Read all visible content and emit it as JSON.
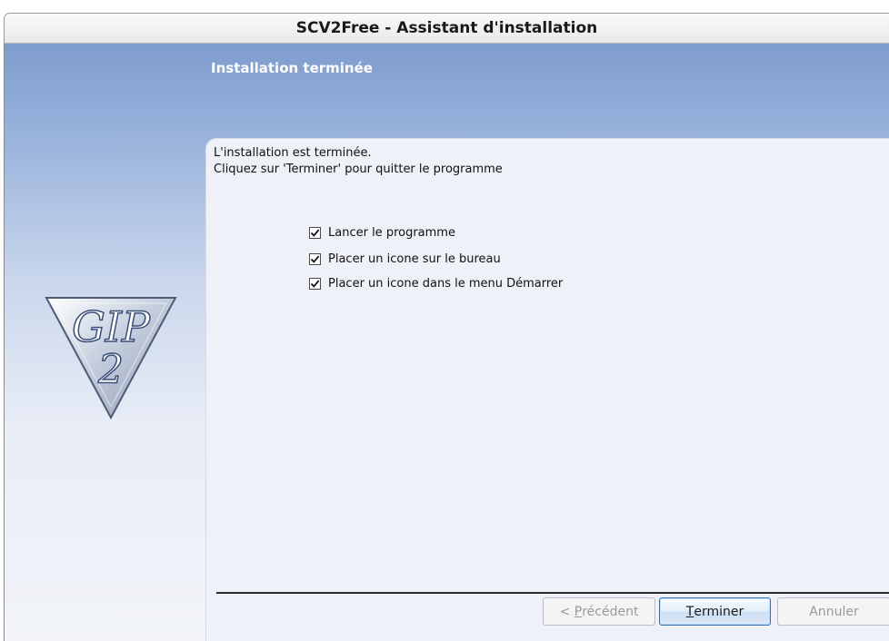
{
  "window": {
    "title": "SCV2Free - Assistant d'installation"
  },
  "header": {
    "title": "Installation terminée"
  },
  "logo": {
    "text": "GIP 2",
    "icon": "gip2-logo"
  },
  "body": {
    "line1": "L'installation est terminée.",
    "line2": "Cliquez sur 'Terminer' pour quitter le programme"
  },
  "options": [
    {
      "label": "Lancer le programme",
      "checked": true
    },
    {
      "label": "Placer un icone sur le bureau",
      "checked": true
    },
    {
      "label": "Placer un icone dans le menu Démarrer",
      "checked": true
    }
  ],
  "buttons": {
    "prev_prefix": "< ",
    "prev_mnemonic": "P",
    "prev_rest": "récédent",
    "finish_mnemonic": "T",
    "finish_rest": "erminer",
    "cancel": "Annuler"
  },
  "colors": {
    "header_gradient_top": "#7e9ccd",
    "panel": "#eef1f7",
    "default_button_border": "#3a6fb0"
  }
}
